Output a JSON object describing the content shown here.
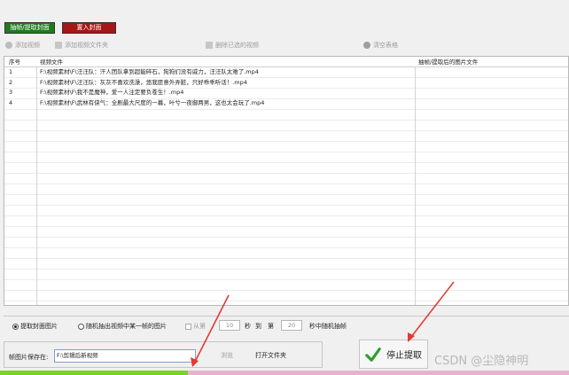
{
  "mode_buttons": {
    "extract_label": "抽帧/提取封面",
    "insert_label": "置入封面"
  },
  "toolbar": {
    "add_video": "添加视频",
    "add_folder": "添加视频文件夹",
    "delete_selected": "删除已选的视频",
    "clear_table": "清空表格"
  },
  "table": {
    "headers": {
      "no": "序号",
      "file": "视频文件",
      "output": "抽帧/提取后的图片文件"
    },
    "rows": [
      {
        "no": "1",
        "file": "F:\\视频素材\\F\\汪汪队：汗人团队拿到超能碎石，狗狗们没有威力，汪汪队太难了.mp4",
        "output": ""
      },
      {
        "no": "2",
        "file": "F:\\视频素材\\F\\汪汪队：灰灰不喜欢洗澡，悠我愿意外弄脏，只好乖乖听话！.mp4",
        "output": ""
      },
      {
        "no": "3",
        "file": "F:\\视频素材\\F\\我不是魔神，爱一人注定要负苍生！.mp4",
        "output": ""
      },
      {
        "no": "4",
        "file": "F:\\视频素材\\F\\武林有侠气：全剧最大尺度的一幕，叶兮一夜御两男，这也太会玩了.mp4",
        "output": ""
      }
    ]
  },
  "options": {
    "radio_cover": "提取封面图片",
    "radio_random": "随机抽出视频中某一帧的图片",
    "from_label": "从第",
    "from_value": "10",
    "sec_label": "秒",
    "to_label": "到",
    "to_sec_label": "第",
    "to_value": "20",
    "random_label": "秒中随机抽帧"
  },
  "save": {
    "label": "帧图片保存在:",
    "path": "F:\\剪辑后新视频",
    "browse": "浏览",
    "open_folder": "打开文件夹"
  },
  "stop_button": {
    "label": "停止提取"
  },
  "progress": {
    "fraction": 0.33
  },
  "watermark": "CSDN @尘隐神明",
  "colors": {
    "extract_button": "#1f7a1f",
    "insert_button": "#a51616",
    "progress_fill": "#7bd326",
    "progress_track": "#e8b2cf",
    "annotation_arrow": "#e53935",
    "check_icon": "#2e9e2e"
  }
}
